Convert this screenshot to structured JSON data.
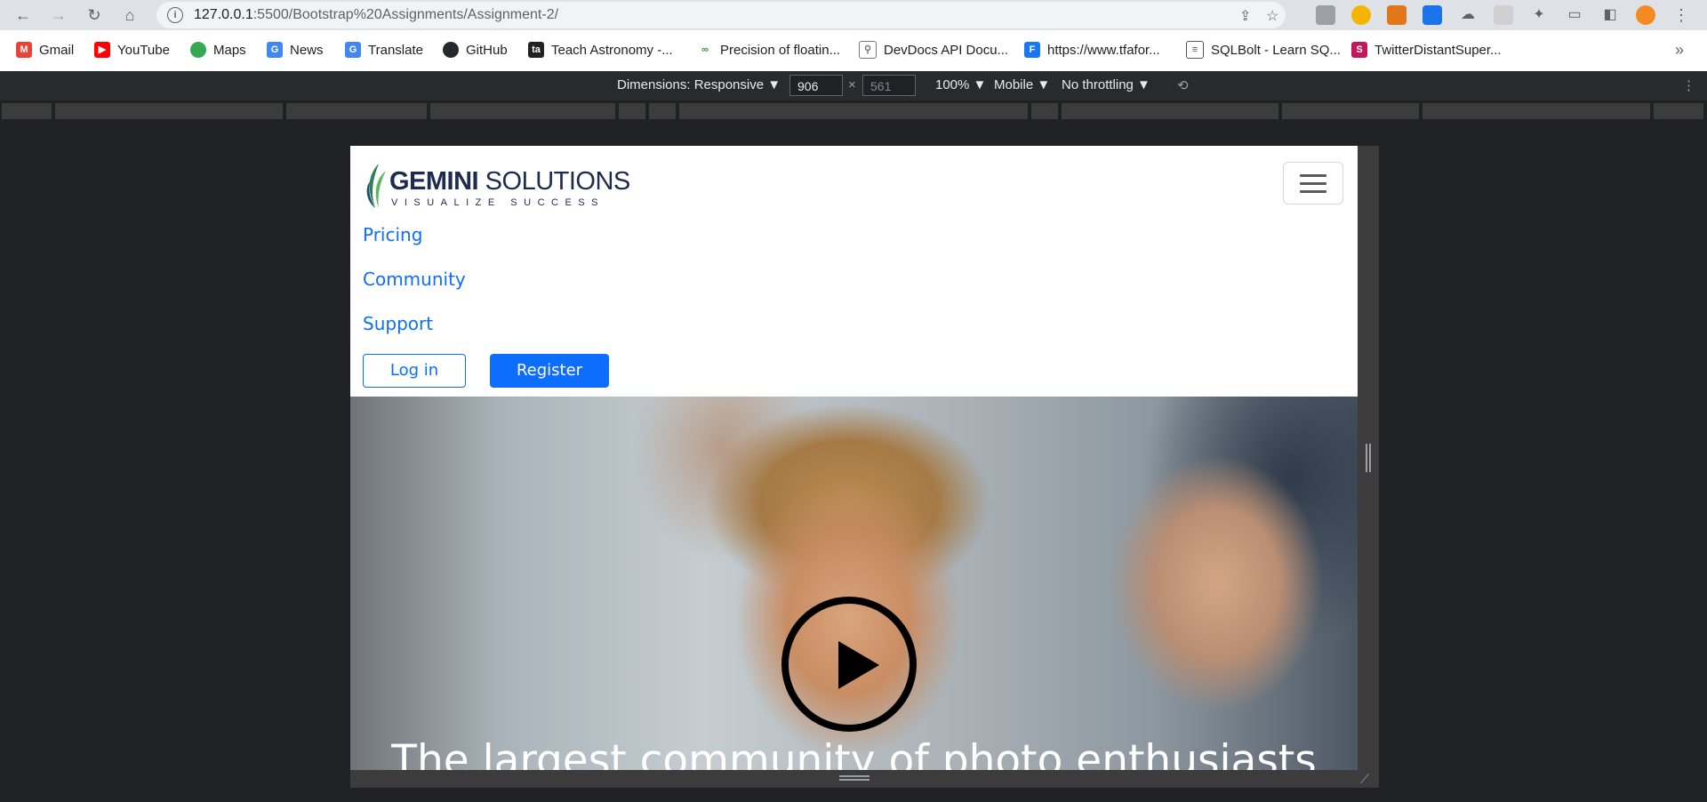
{
  "browser": {
    "url_host": "127.0.0.1",
    "url_path": ":5500/Bootstrap%20Assignments/Assignment-2/",
    "bookmarks": [
      {
        "label": "Gmail",
        "icon": "gmail-icon",
        "color": "#ea4335"
      },
      {
        "label": "YouTube",
        "icon": "youtube-icon",
        "color": "#ff0000"
      },
      {
        "label": "Maps",
        "icon": "maps-icon",
        "color": "#34a853"
      },
      {
        "label": "News",
        "icon": "news-icon",
        "color": "#4285f4"
      },
      {
        "label": "Translate",
        "icon": "translate-icon",
        "color": "#4285f4"
      },
      {
        "label": "GitHub",
        "icon": "github-icon",
        "color": "#24292e"
      },
      {
        "label": "Teach Astronomy -...",
        "icon": "astronomy-icon",
        "color": "#222222"
      },
      {
        "label": "Precision of floatin...",
        "icon": "gfg-icon",
        "color": "#2f8d46"
      },
      {
        "label": "DevDocs API Docu...",
        "icon": "devdocs-icon",
        "color": "#777777"
      },
      {
        "label": "https://www.tfafor...",
        "icon": "facebook-icon",
        "color": "#1877f2"
      },
      {
        "label": "SQLBolt - Learn SQ...",
        "icon": "database-icon",
        "color": "#555555"
      },
      {
        "label": "TwitterDistantSuper...",
        "icon": "s-icon",
        "color": "#c2185b"
      }
    ],
    "more_bookmarks": "»"
  },
  "devtools": {
    "dimensions_label": "Dimensions: Responsive ▼",
    "width": "906",
    "times": "×",
    "height": "561",
    "zoom": "100% ▼",
    "device": "Mobile ▼",
    "throttling": "No throttling ▼"
  },
  "page": {
    "logo_brand_bold": "GEMINI",
    "logo_brand_rest": " SOLUTIONS",
    "logo_tagline": "VISUALIZE SUCCESS",
    "nav_links": [
      "Pricing",
      "Community",
      "Support"
    ],
    "login_label": "Log in",
    "register_label": "Register",
    "hero_headline": "The largest community of photo enthusiasts",
    "colors": {
      "primary": "#0d6efd",
      "brand_navy": "#1d2b4f",
      "leaf_green": "#3aa36b"
    }
  }
}
